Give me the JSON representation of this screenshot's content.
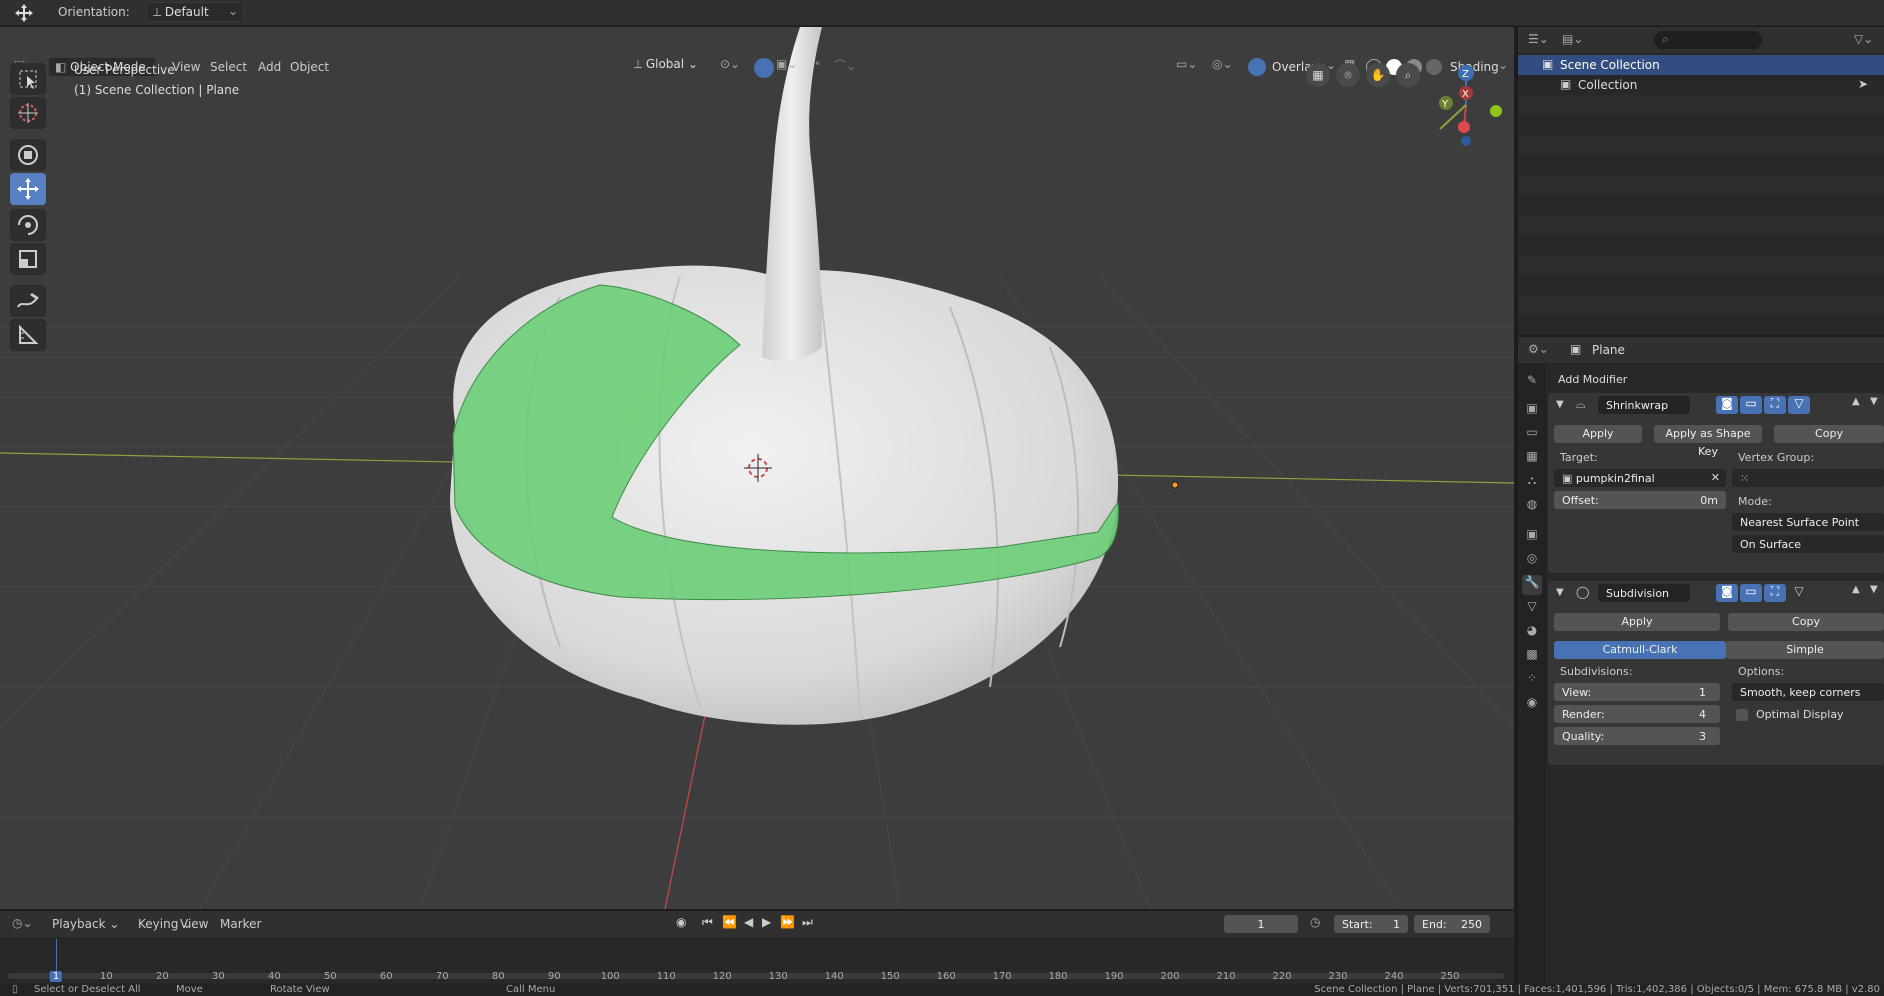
{
  "topbar": {
    "orientation_label": "Orientation:",
    "orientation_value": "Default"
  },
  "viewport_header": {
    "mode": "Object Mode",
    "menus": [
      "View",
      "Select",
      "Add",
      "Object"
    ],
    "transform_orientation": "Global",
    "overlays_label": "Overlays",
    "shading_label": "Shading"
  },
  "viewport": {
    "perspective_text": "User Perspective",
    "collection_text": "(1) Scene Collection | Plane",
    "gizmo_labels": {
      "z": "Z",
      "y": "Y",
      "x": "X"
    },
    "colors": {
      "background": "#3d3d3d",
      "pumpkin": "#dcdcdc",
      "shrinkwrap_band": "#6fcf7a",
      "x_axis": "#c8494b",
      "y_axis": "#8aa33e",
      "active_tool": "#5680c2"
    }
  },
  "toolbar": {
    "tools": [
      "select-box",
      "cursor",
      "move-all",
      "move",
      "rotate",
      "scale",
      "annotate",
      "measure"
    ],
    "active": "move"
  },
  "outliner": {
    "search_placeholder": "",
    "items": [
      {
        "label": "Scene Collection",
        "selected": true
      },
      {
        "label": "Collection",
        "selected": false
      }
    ]
  },
  "properties": {
    "object_name": "Plane",
    "add_modifier": "Add Modifier",
    "modifiers": [
      {
        "name": "Shrinkwrap",
        "apply": "Apply",
        "apply_shape_key": "Apply as Shape Key",
        "copy": "Copy",
        "target_label": "Target:",
        "target_value": "pumpkin2final",
        "vertex_group_label": "Vertex Group:",
        "offset_label": "Offset:",
        "offset_value": "0m",
        "mode_label": "Mode:",
        "mode_value": "Nearest Surface Point",
        "mode_value2": "On Surface"
      },
      {
        "name": "Subdivision",
        "apply": "Apply",
        "copy": "Copy",
        "algorithm_options": [
          "Catmull-Clark",
          "Simple"
        ],
        "algorithm_selected": "Catmull-Clark",
        "subdivisions_label": "Subdivisions:",
        "view_label": "View:",
        "view_value": "1",
        "render_label": "Render:",
        "render_value": "4",
        "quality_label": "Quality:",
        "quality_value": "3",
        "options_label": "Options:",
        "options_value": "Smooth, keep corners",
        "optimal_display_label": "Optimal Display",
        "optimal_display_checked": false
      }
    ]
  },
  "timeline": {
    "menus": [
      "Playback",
      "Keying",
      "View",
      "Marker"
    ],
    "current_frame": "1",
    "start_label": "Start:",
    "start_value": "1",
    "end_label": "End:",
    "end_value": "250",
    "ruler_ticks": [
      "1",
      "10",
      "20",
      "30",
      "40",
      "50",
      "60",
      "70",
      "80",
      "90",
      "100",
      "110",
      "120",
      "130",
      "140",
      "150",
      "160",
      "170",
      "180",
      "190",
      "200",
      "210",
      "220",
      "230",
      "240",
      "250"
    ]
  },
  "statusbar": {
    "hint_select": "Select or Deselect All",
    "hint_move": "Move",
    "hint_rotate": "Rotate View",
    "hint_menu": "Call Menu",
    "stats": "Scene Collection | Plane | Verts:701,351 | Faces:1,401,596 | Tris:1,402,386 | Objects:0/5 | Mem: 675.8 MB | v2.80"
  }
}
